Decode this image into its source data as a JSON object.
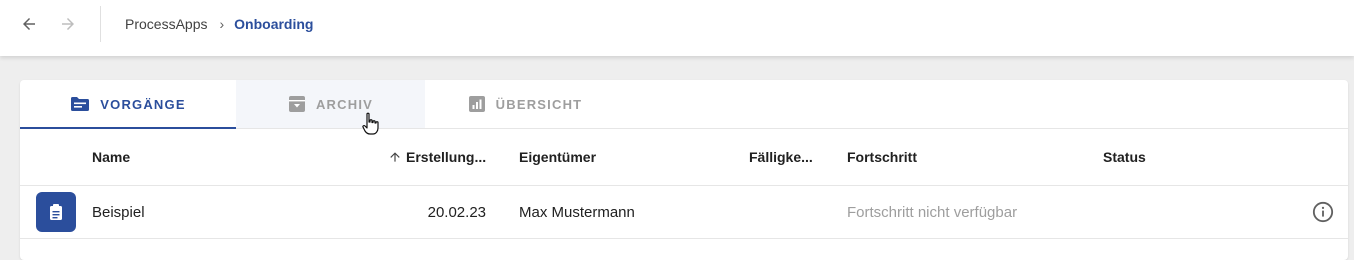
{
  "breadcrumb": {
    "root": "ProcessApps",
    "separator": "›",
    "current": "Onboarding"
  },
  "tabs": [
    {
      "label": "VORGÄNGE",
      "icon": "folder-list-icon",
      "active": true
    },
    {
      "label": "ARCHIV",
      "icon": "archive-icon",
      "active": false
    },
    {
      "label": "ÜBERSICHT",
      "icon": "chart-icon",
      "active": false
    }
  ],
  "table": {
    "columns": {
      "name": "Name",
      "created": "Erstellung...",
      "owner": "Eigentümer",
      "due": "Fälligke...",
      "progress": "Fortschritt",
      "status": "Status"
    },
    "sort_icon": "arrow-up-icon",
    "rows": [
      {
        "icon": "clipboard-icon",
        "name": "Beispiel",
        "created": "20.02.23",
        "owner": "Max Mustermann",
        "due": "",
        "progress": "Fortschritt nicht verfügbar",
        "status": ""
      }
    ]
  },
  "colors": {
    "accent": "#2b4e9c",
    "muted": "#9e9e9e",
    "background": "#eeeeee"
  }
}
